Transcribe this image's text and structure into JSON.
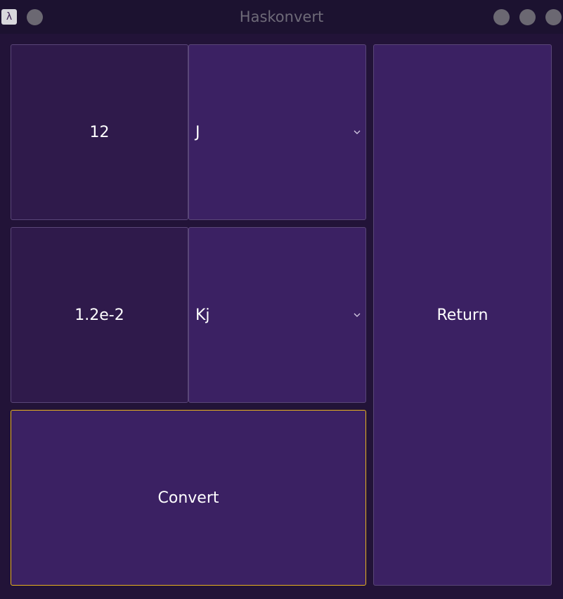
{
  "window": {
    "title": "Haskonvert"
  },
  "input": {
    "value": "12"
  },
  "from_unit": {
    "selected": "J"
  },
  "output": {
    "value": "1.2e-2"
  },
  "to_unit": {
    "selected": "Kj"
  },
  "actions": {
    "convert_label": "Convert",
    "return_label": "Return"
  },
  "colors": {
    "background": "#221338",
    "panel": "#3b2163",
    "display": "#2f1a4b",
    "focus_border": "#e6b21e",
    "text": "#ffffff"
  }
}
